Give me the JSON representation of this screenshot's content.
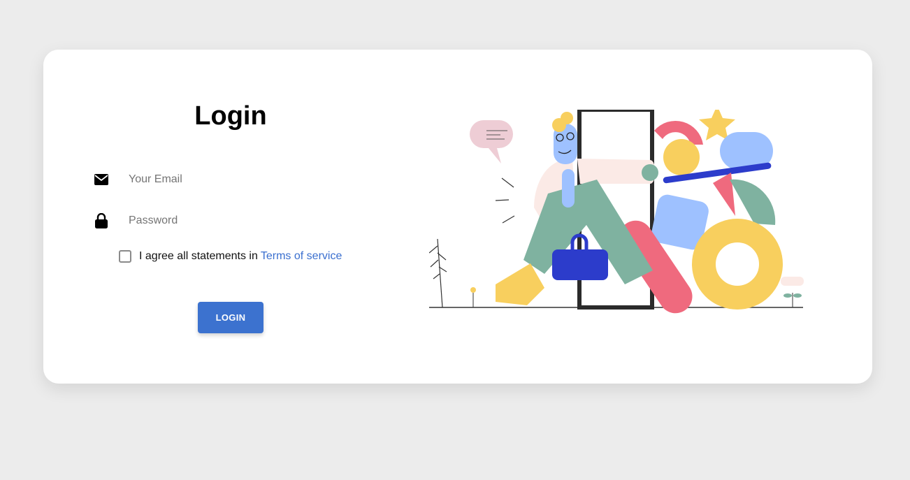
{
  "form": {
    "title": "Login",
    "email_placeholder": "Your Email",
    "password_placeholder": "Password",
    "agree_text": "I agree all statements in",
    "terms_link": "Terms of service",
    "login_label": "LOGIN"
  },
  "colors": {
    "background": "#ececec",
    "card": "#ffffff",
    "accent": "#3c72cf",
    "link": "#3a6fcf"
  },
  "icons": {
    "email": "envelope-icon",
    "password": "lock-icon",
    "illustration": "person-leaving-door-illustration"
  }
}
